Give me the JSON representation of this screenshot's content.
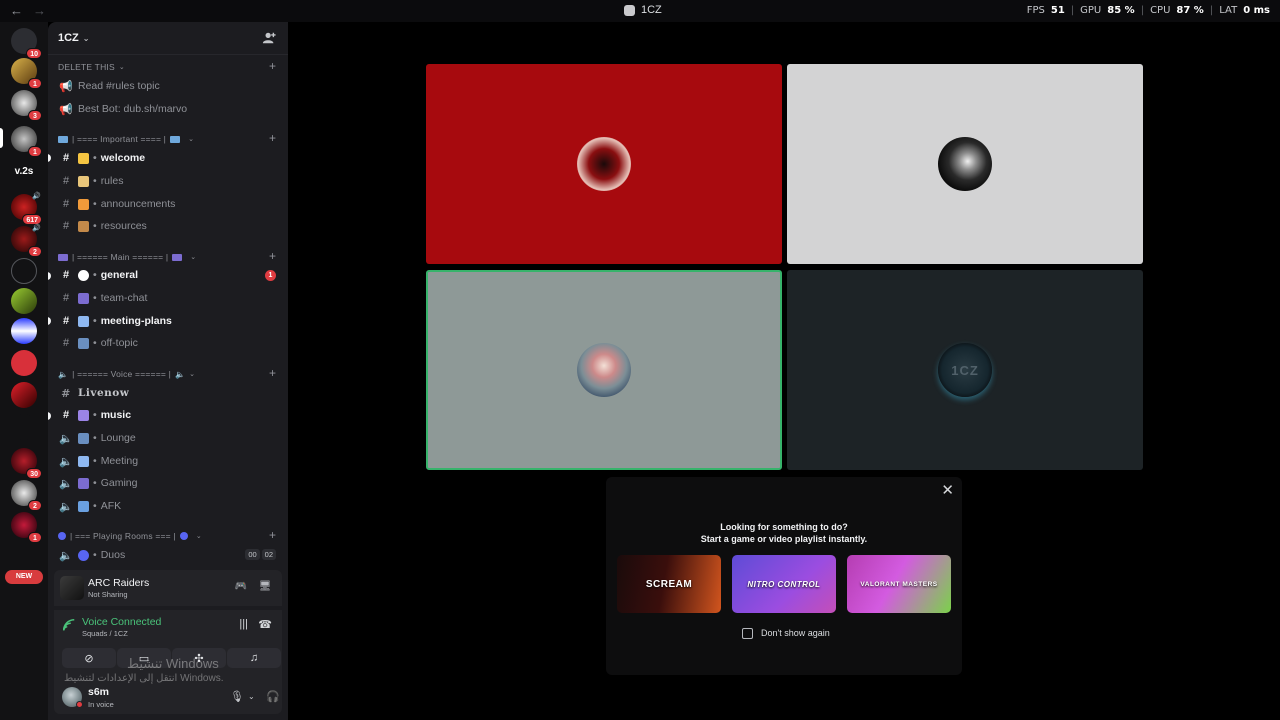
{
  "titlebar": {
    "back": "←",
    "forward": "→",
    "title": "1CZ",
    "stats": {
      "fps_label": "FPS",
      "fps": "51",
      "gpu_label": "GPU",
      "gpu": "85 %",
      "cpu_label": "CPU",
      "cpu": "87 %",
      "lat_label": "LAT",
      "lat": "0 ms"
    }
  },
  "rail": {
    "dm_badge": "10",
    "badges": [
      "1",
      "3",
      "1",
      "617",
      "2",
      "30",
      "2",
      "1"
    ],
    "v2s": "v.2s",
    "new": "NEW"
  },
  "server": {
    "name": "1CZ",
    "categories": [
      {
        "label": "DELETE THIS"
      },
      {
        "label": "| ==== Important ==== |"
      },
      {
        "label": "| ====== Main ====== |"
      },
      {
        "label": "| ====== Voice ====== |"
      },
      {
        "label": "| === Playing Rooms === |"
      }
    ],
    "channels": {
      "read_rules": "Read #rules topic",
      "best_bot": "Best Bot: dub.sh/marvo",
      "welcome": "welcome",
      "rules": "rules",
      "announcements": "announcements",
      "resources": "resources",
      "general": "general",
      "general_mentions": "1",
      "team_chat": "team-chat",
      "meeting_plans": "meeting-plans",
      "off_topic": "off-topic",
      "livenow": "Livenow",
      "music": "music",
      "lounge": "Lounge",
      "meeting": "Meeting",
      "gaming": "Gaming",
      "afk": "AFK",
      "duos": "Duos",
      "duos_count_a": "00",
      "duos_count_b": "02"
    }
  },
  "activity": {
    "title": "ARC Raiders",
    "subtitle": "Not Sharing"
  },
  "voice": {
    "status": "Voice Connected",
    "location": "Squads / 1CZ"
  },
  "user": {
    "name": "s6m",
    "status": "In voice"
  },
  "watermark": {
    "line1": "تنشيط Windows",
    "line2": "انتقل إلى الإعدادات لتنشيط Windows."
  },
  "popup": {
    "heading": "Looking for something to do?",
    "subheading": "Start a game or video playlist instantly.",
    "cards": [
      "SCREAM",
      "NITRO CONTROL",
      "VALORANT MASTERS"
    ],
    "dont_show": "Don't show again"
  },
  "tile_dark_text": "1CZ",
  "colors": {
    "accent_green": "#37b36b",
    "mention_red": "#e03c41",
    "tile_red": "#a70a0e",
    "tile_light": "#d3d3d4",
    "tile_gray": "#8e9997",
    "tile_dark": "#1d2326"
  }
}
